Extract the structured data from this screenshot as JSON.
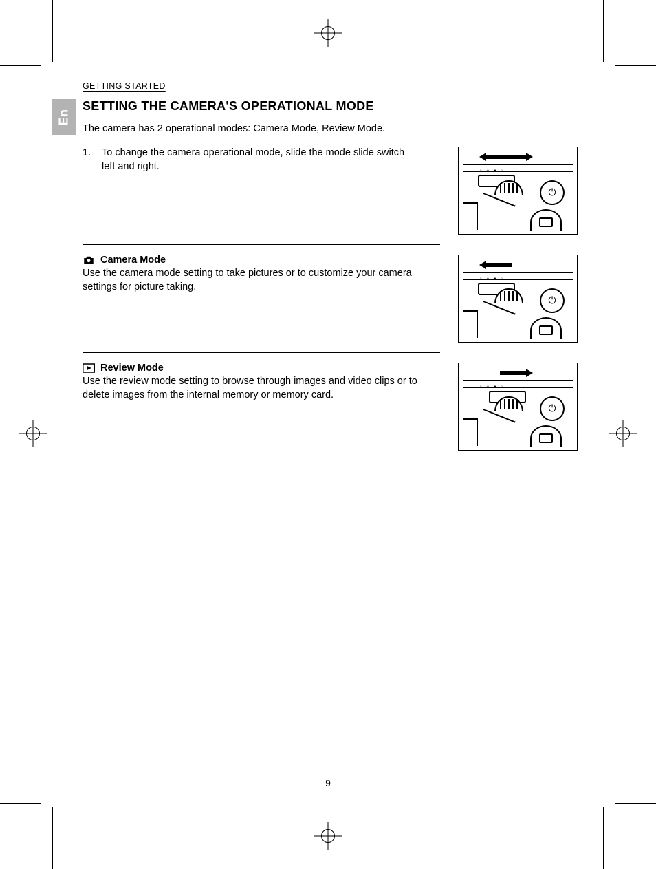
{
  "running_head": "GETTING STARTED",
  "lang_tab": "En",
  "title": "SETTING THE CAMERA'S OPERATIONAL MODE",
  "intro": "The camera has 2 operational modes: Camera Mode, Review Mode.",
  "step1_num": "1.",
  "step1_text": "To change the camera operational mode, slide the mode slide switch left and right.",
  "camera_mode": {
    "heading": "Camera Mode",
    "desc": "Use the camera mode setting to take pictures or to customize your camera settings for picture taking."
  },
  "review_mode": {
    "heading": "Review Mode",
    "desc": "Use the review mode setting to browse through images and video clips or to delete images from the internal memory or memory card."
  },
  "slider_icons_label": "◦ • • ▷",
  "page_number": "9"
}
